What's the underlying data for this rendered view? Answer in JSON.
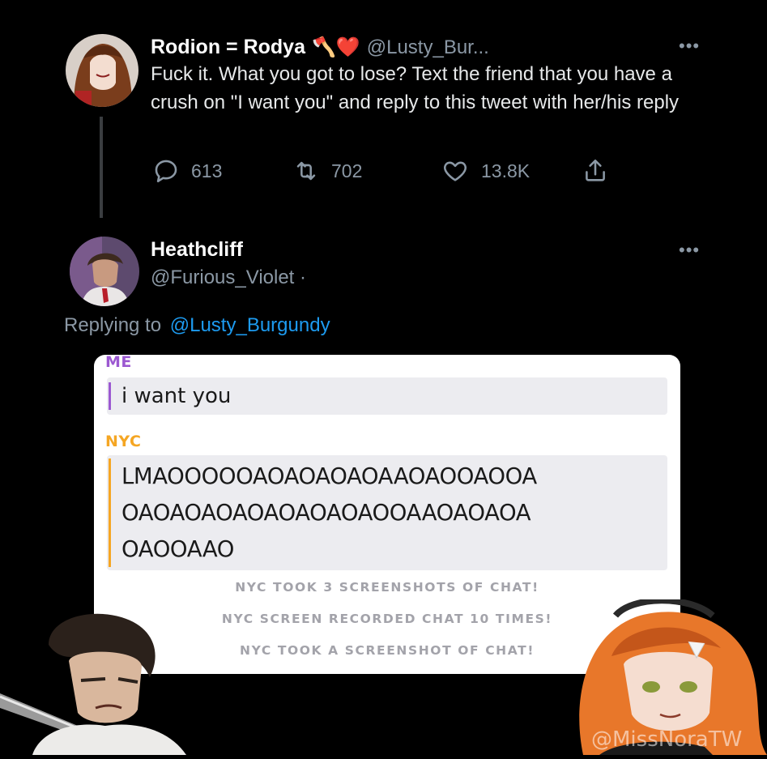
{
  "original_tweet": {
    "display_name": "Rodion = Rodya",
    "name_emojis": "🪓❤️",
    "handle": "@Lusty_Bur...",
    "more": "•••",
    "text": "Fuck it. What you got to lose? Text the friend that you have a crush on \"I want you\" and reply to this tweet with her/his reply",
    "stats": {
      "replies": "613",
      "retweets": "702",
      "likes": "13.8K"
    }
  },
  "reply_tweet": {
    "display_name": "Heathcliff",
    "handle": "@Furious_Violet ·",
    "more": "•••",
    "replying_to_prefix": "Replying to",
    "replying_to_handle": "@Lusty_Burgundy"
  },
  "snap_chat": {
    "me_label": "ME",
    "me_message": "i want you",
    "nyc_label": "NYC",
    "nyc_message_lines": [
      "LMAOOOOOAOAOAOAOAAOAOOAOOA",
      "OAOAOAOAOAOAOAOAOOAAOAOAOA",
      "OAOOAAO"
    ],
    "notices": [
      "NYC TOOK 3 SCREENSHOTS OF CHAT!",
      "NYC SCREEN RECORDED CHAT 10 TIMES!",
      "NYC TOOK A SCREENSHOT OF CHAT!"
    ],
    "colors": {
      "me": "#9c59d1",
      "nyc": "#f5a623"
    }
  },
  "watermark": "@MissNoraTW",
  "colors": {
    "link": "#1d9bf0",
    "muted": "#8b98a5"
  }
}
